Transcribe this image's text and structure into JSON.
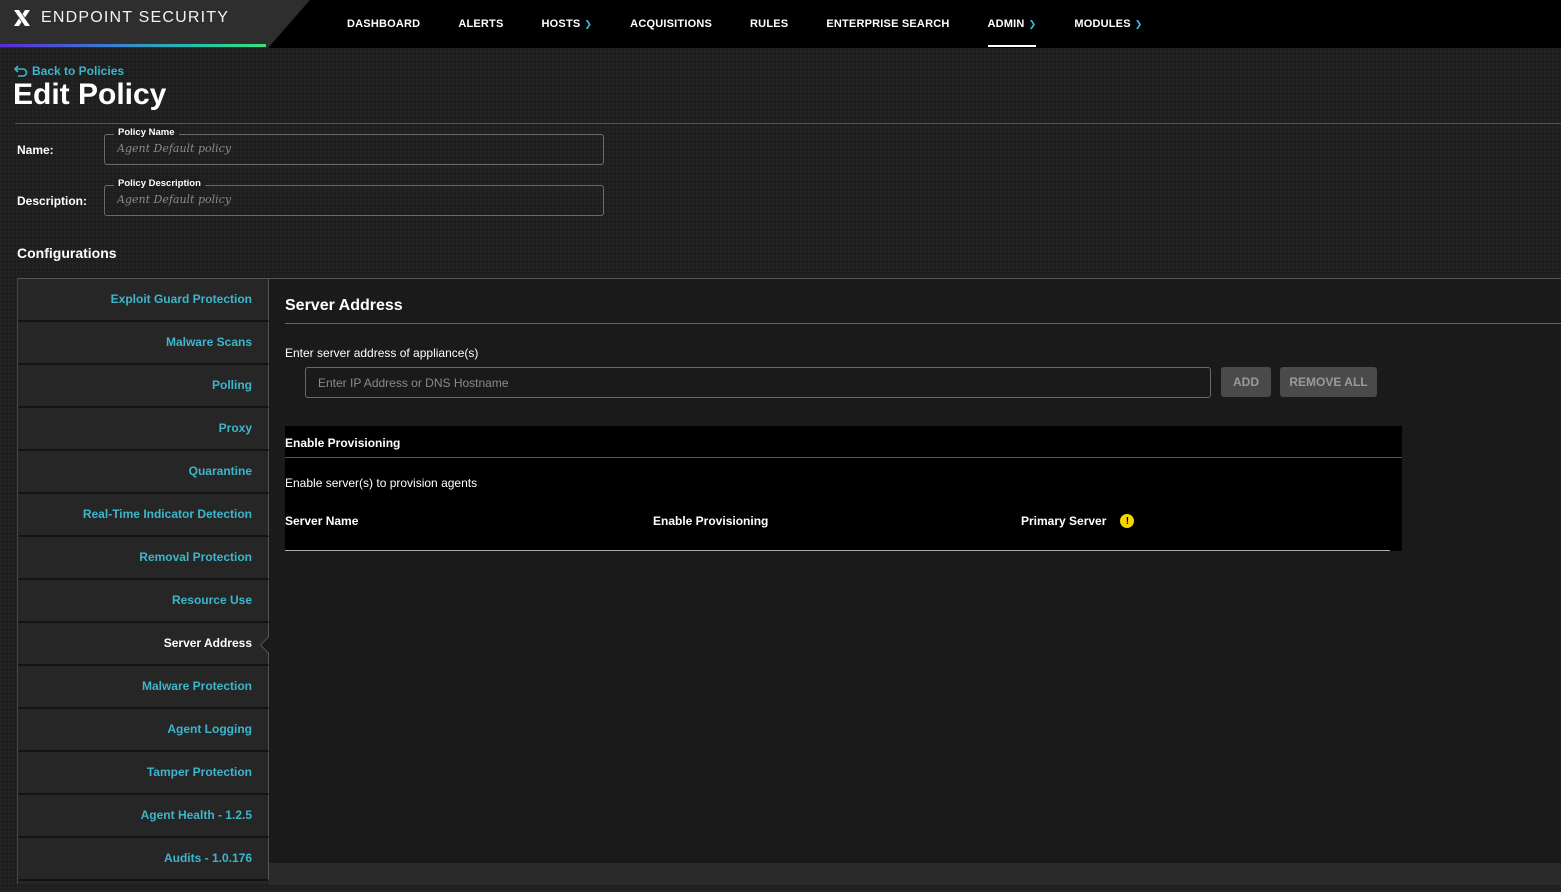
{
  "brand": {
    "name": "ENDPOINT SECURITY",
    "logo_icon": "x-logo-icon"
  },
  "nav": {
    "items": [
      {
        "label": "DASHBOARD",
        "dropdown": false
      },
      {
        "label": "ALERTS",
        "dropdown": false
      },
      {
        "label": "HOSTS",
        "dropdown": true
      },
      {
        "label": "ACQUISITIONS",
        "dropdown": false
      },
      {
        "label": "RULES",
        "dropdown": false
      },
      {
        "label": "ENTERPRISE SEARCH",
        "dropdown": false
      },
      {
        "label": "ADMIN",
        "dropdown": true,
        "active": true
      },
      {
        "label": "MODULES",
        "dropdown": true
      }
    ]
  },
  "header": {
    "back_label": "Back to Policies",
    "title": "Edit Policy"
  },
  "form": {
    "name_label": "Name:",
    "name_legend": "Policy Name",
    "name_placeholder": "Agent Default policy",
    "description_label": "Description:",
    "description_legend": "Policy Description",
    "description_placeholder": "Agent Default policy"
  },
  "configurations": {
    "title": "Configurations",
    "items": [
      "Exploit Guard Protection",
      "Malware Scans",
      "Polling",
      "Proxy",
      "Quarantine",
      "Real-Time Indicator Detection",
      "Removal Protection",
      "Resource Use",
      "Server Address",
      "Malware Protection",
      "Agent Logging",
      "Tamper Protection",
      "Agent Health - 1.2.5",
      "Audits - 1.0.176"
    ],
    "active_index": 8
  },
  "server_address": {
    "title": "Server Address",
    "hint": "Enter server address of appliance(s)",
    "input_placeholder": "Enter IP Address or DNS Hostname",
    "add_label": "ADD",
    "remove_all_label": "REMOVE ALL",
    "provisioning": {
      "title": "Enable Provisioning",
      "hint": "Enable server(s) to provision agents",
      "columns": [
        "Server Name",
        "Enable Provisioning",
        "Primary Server"
      ]
    }
  },
  "colors": {
    "accent_link": "#3cb6cc",
    "warning": "#f5d400",
    "nav_background": "#000000"
  }
}
